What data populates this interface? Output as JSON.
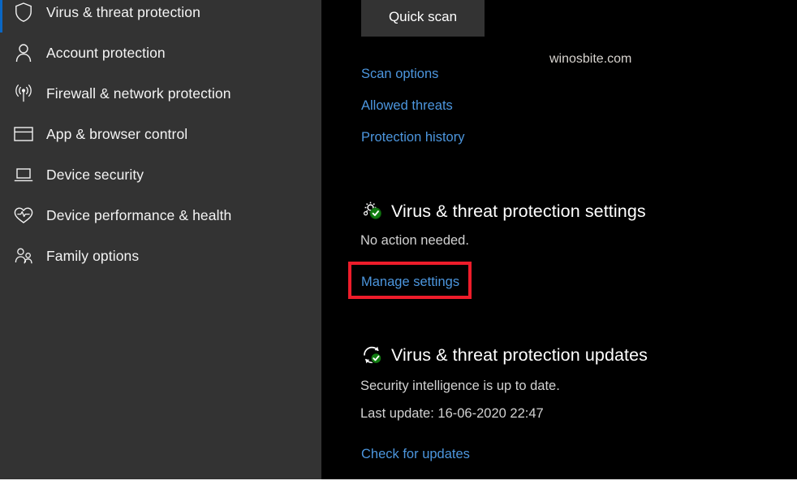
{
  "window": {
    "title": "Windows Security",
    "accent_color": "#0a67c4",
    "link_color": "#4c96de",
    "sidebar_bg": "#333333",
    "content_bg": "#000000",
    "highlight_color": "#ee1c2a"
  },
  "sidebar": {
    "items": [
      {
        "label": "Virus & threat protection",
        "icon": "shield-icon",
        "selected": true
      },
      {
        "label": "Account protection",
        "icon": "person-icon",
        "selected": false
      },
      {
        "label": "Firewall & network protection",
        "icon": "wireless-signal-icon",
        "selected": false
      },
      {
        "label": "App & browser control",
        "icon": "browser-window-icon",
        "selected": false
      },
      {
        "label": "Device security",
        "icon": "laptop-icon",
        "selected": false
      },
      {
        "label": "Device performance & health",
        "icon": "heart-pulse-icon",
        "selected": false
      },
      {
        "label": "Family options",
        "icon": "people-group-icon",
        "selected": false
      }
    ]
  },
  "main": {
    "quick_scan_button": "Quick scan",
    "links": {
      "scan_options": "Scan options",
      "allowed_threats": "Allowed threats",
      "protection_history": "Protection history",
      "manage_settings": "Manage settings",
      "check_for_updates": "Check for updates"
    },
    "watermark": "winosbite.com",
    "settings_section": {
      "icon": "gear-with-green-check-icon",
      "title": "Virus & threat protection settings",
      "status": "No action needed."
    },
    "updates_section": {
      "icon": "refresh-with-green-check-icon",
      "title": "Virus & threat protection updates",
      "status": "Security intelligence is up to date.",
      "last_update": "Last update: 16-06-2020 22:47"
    }
  }
}
